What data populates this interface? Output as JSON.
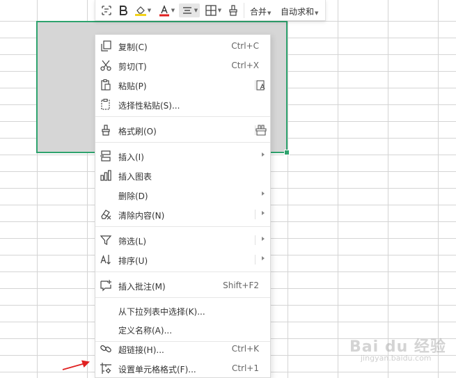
{
  "toolbar": {
    "merge_label": "合并",
    "autosum_label": "自动求和"
  },
  "context_menu": {
    "items": [
      {
        "id": "copy",
        "icon": "copy-icon",
        "label": "复制(C)",
        "shortcut": "Ctrl+C"
      },
      {
        "id": "cut",
        "icon": "scissors-icon",
        "label": "剪切(T)",
        "shortcut": "Ctrl+X"
      },
      {
        "id": "paste",
        "icon": "paste-icon",
        "label": "粘贴(P)",
        "right_icon": "paste-text-icon"
      },
      {
        "id": "paste-special",
        "icon": "paste-special-icon",
        "label": "选择性粘贴(S)..."
      },
      {
        "id": "format-painter",
        "icon": "format-painter-icon",
        "label": "格式刷(O)",
        "right_icon": "format-painter-multi-icon"
      },
      {
        "id": "insert",
        "icon": "insert-icon",
        "label": "插入(I)",
        "submenu": true
      },
      {
        "id": "insert-chart",
        "icon": "chart-icon",
        "label": "插入图表"
      },
      {
        "id": "delete",
        "label": "删除(D)",
        "submenu": true
      },
      {
        "id": "clear-contents",
        "icon": "eraser-icon",
        "label": "清除内容(N)",
        "submenu": true
      },
      {
        "id": "filter",
        "icon": "filter-icon",
        "label": "筛选(L)",
        "submenu": true
      },
      {
        "id": "sort",
        "icon": "sort-icon",
        "label": "排序(U)",
        "submenu": true
      },
      {
        "id": "insert-comment",
        "icon": "comment-icon",
        "label": "插入批注(M)",
        "shortcut": "Shift+F2"
      },
      {
        "id": "pick-from-list",
        "label": "从下拉列表中选择(K)..."
      },
      {
        "id": "define-name",
        "label": "定义名称(A)..."
      },
      {
        "id": "hyperlink",
        "icon": "link-icon",
        "label": "超链接(H)...",
        "shortcut": "Ctrl+K"
      },
      {
        "id": "format-cells",
        "icon": "format-cells-icon",
        "label": "设置单元格格式(F)...",
        "shortcut": "Ctrl+1"
      }
    ]
  },
  "colors": {
    "selection_border": "#2fa36e",
    "selection_fill": "#d6d6d6",
    "font_color_bar": "#e02020",
    "fill_color_bar": "#f3d21a",
    "annotation_arrow": "#e02020"
  },
  "watermark": {
    "logo_text": "Bai du 经验",
    "url": "jingyan.baidu.com"
  }
}
